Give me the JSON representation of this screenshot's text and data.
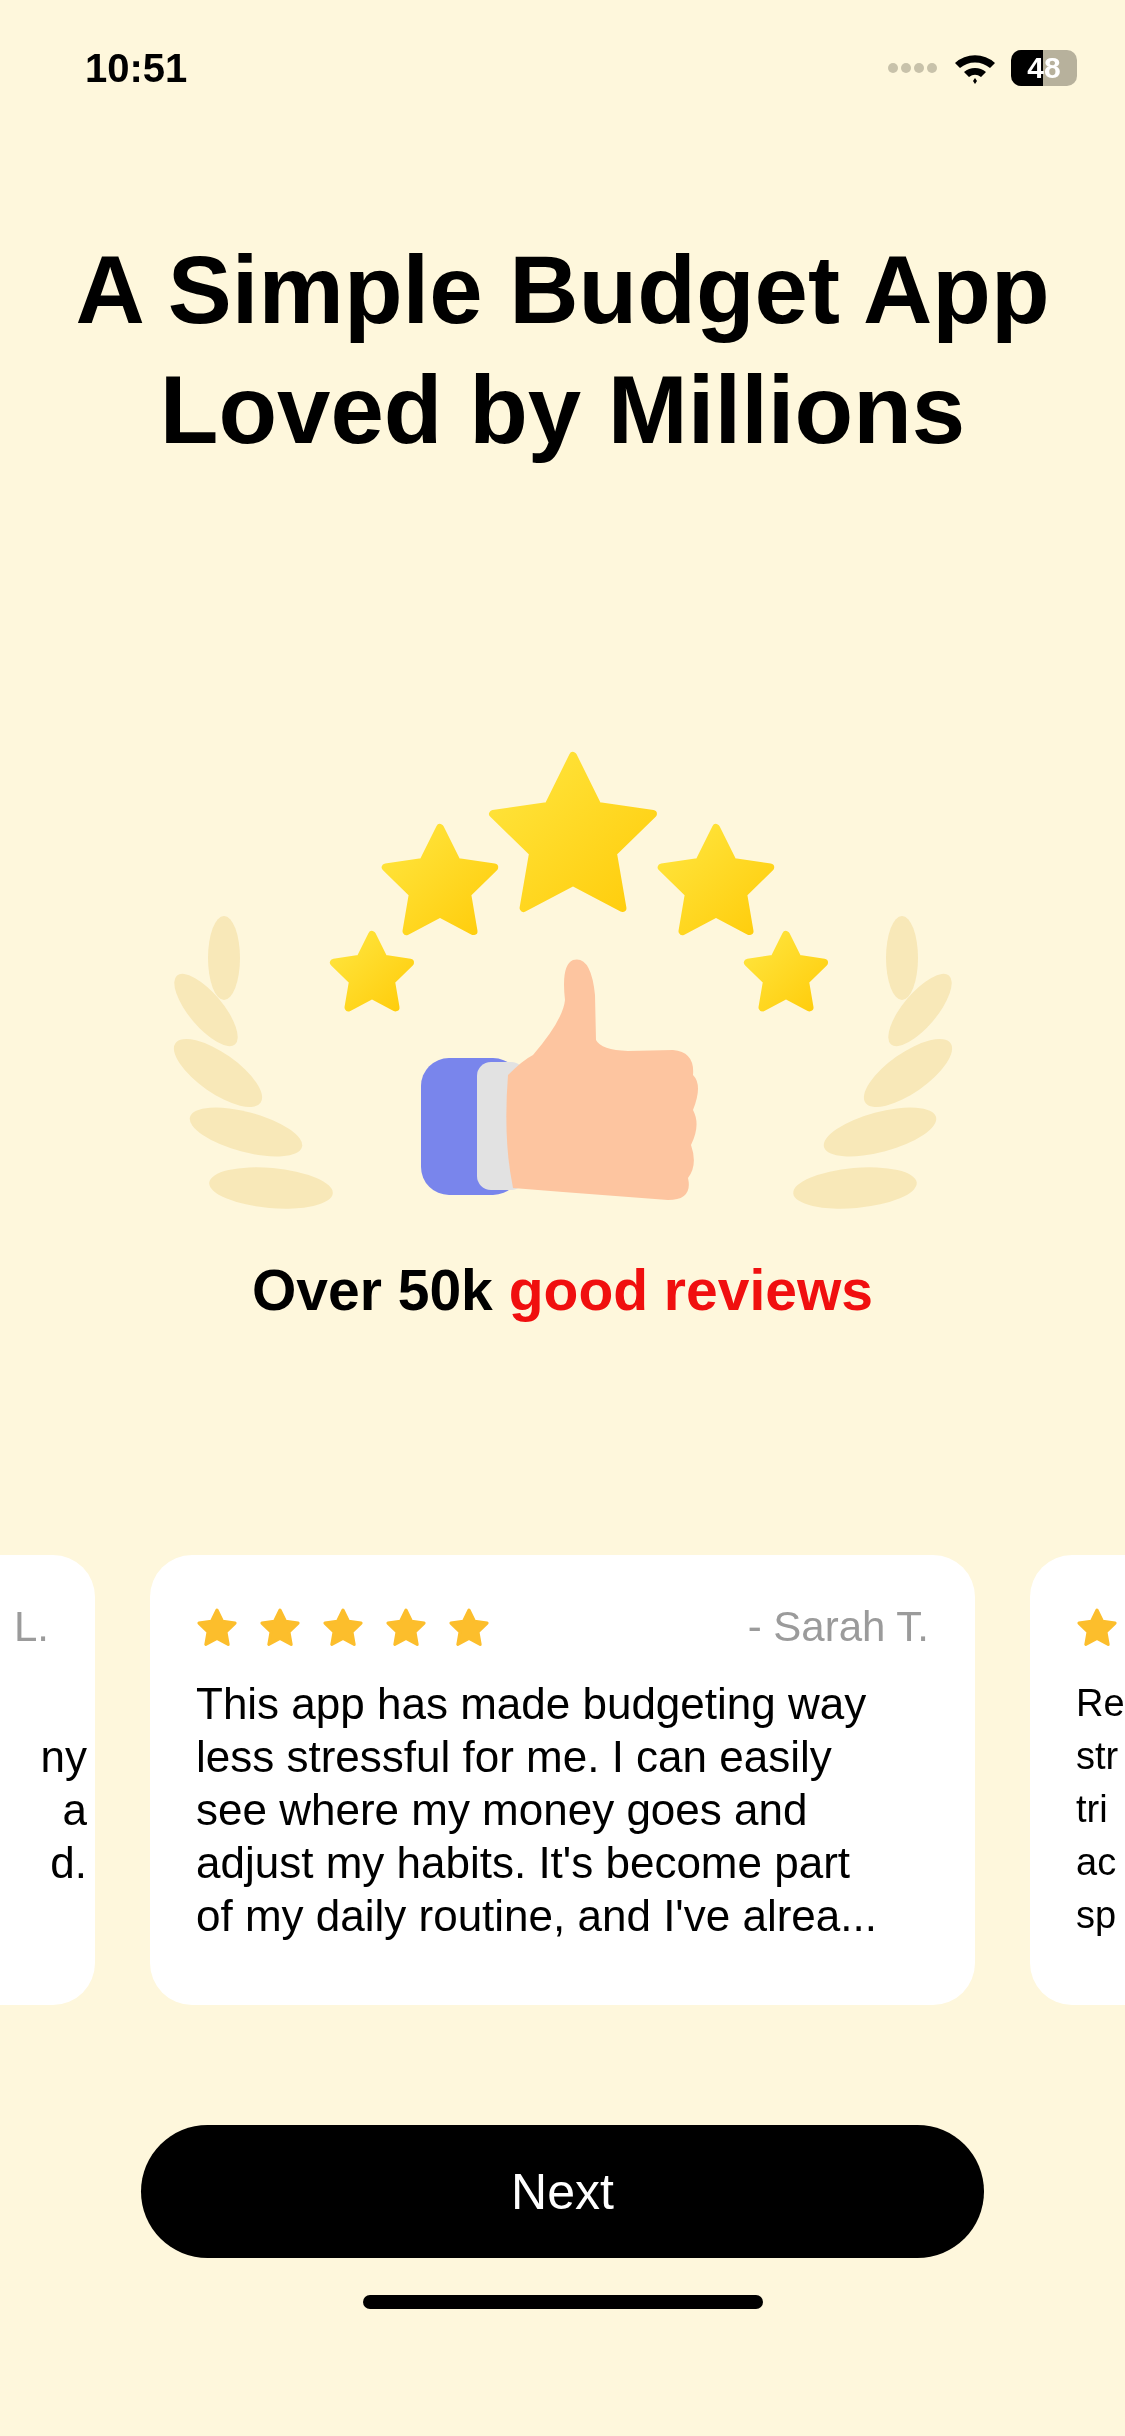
{
  "status_bar": {
    "time": "10:51",
    "battery": "48"
  },
  "title": "A Simple Budget App\nLoved by Millions",
  "subtitle": {
    "text": "Over 50k",
    "highlight": "good reviews"
  },
  "reviews": [
    {
      "kind": "left-edge",
      "author": "L.",
      "text": "ny\na\nd."
    },
    {
      "kind": "full",
      "stars": 5,
      "author": "- Sarah T.",
      "text": "This app has made budgeting way\nless stressful for me. I can easily\nsee where my money goes and\nadjust my habits. It's become part\nof my daily routine, and I've alrea..."
    },
    {
      "kind": "right-edge",
      "text": "Re\nstr\ntri\nac\nsp"
    }
  ],
  "button": {
    "label": "Next"
  }
}
